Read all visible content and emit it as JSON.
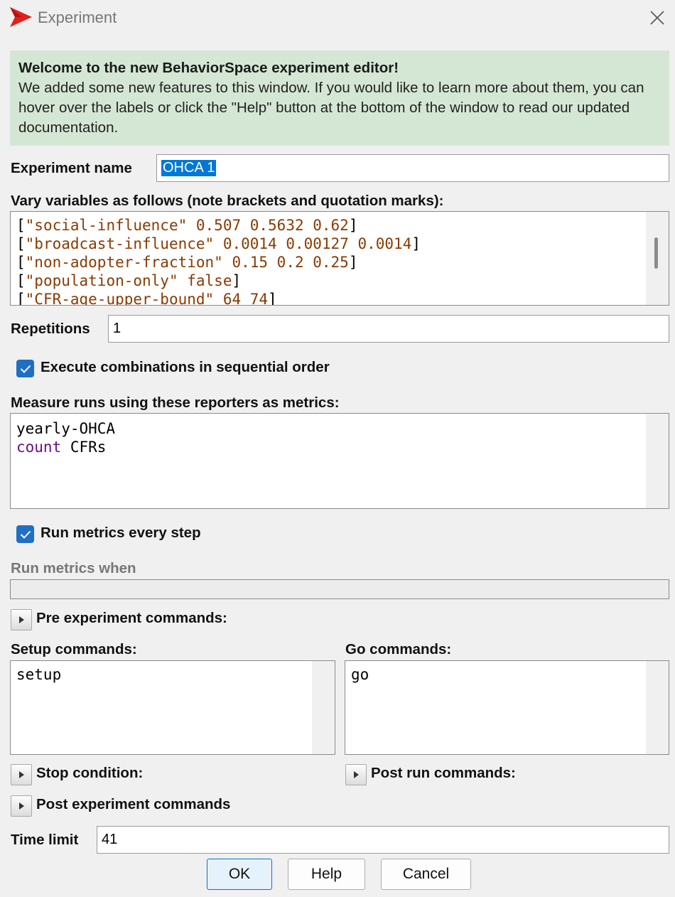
{
  "window": {
    "title": "Experiment",
    "logo_icon": "netlogo-red-arrow-icon",
    "close_icon": "close-x-icon",
    "accent": "#e0201b"
  },
  "banner": {
    "title": "Welcome to the new BehaviorSpace experiment editor!",
    "text": "We added some new features to this window. If you would like to learn more about them, you can hover over the labels or click the \"Help\" button at the bottom of the window to read our updated documentation.",
    "color": "#d4e7d4"
  },
  "experiment_name": {
    "label": "Experiment name",
    "value": "OHCA 1"
  },
  "vary_variables": {
    "label": "Vary variables as follows (note brackets and quotation marks):",
    "lines": [
      {
        "name": "\"social-influence\"",
        "values": "0.507 0.5632 0.62"
      },
      {
        "name": "\"broadcast-influence\"",
        "values": "0.0014 0.00127 0.0014"
      },
      {
        "name": "\"non-adopter-fraction\"",
        "values": "0.15 0.2 0.25"
      },
      {
        "name": "\"population-only\"",
        "values": "false"
      },
      {
        "name": "\"CFR-age-upper-bound\"",
        "values": "64 74"
      }
    ]
  },
  "repetitions": {
    "label": "Repetitions",
    "value": "1"
  },
  "sequential": {
    "label": "Execute combinations in sequential order",
    "checked": true
  },
  "metrics": {
    "label": "Measure runs using these reporters as metrics:",
    "line1": "yearly-OHCA",
    "line2_keyword": "count",
    "line2_rest": " CFRs"
  },
  "run_every_step": {
    "label": "Run metrics every step",
    "checked": true
  },
  "run_metrics_when": {
    "label": "Run metrics when",
    "value": ""
  },
  "pre_experiment": {
    "label": "Pre experiment commands:"
  },
  "setup": {
    "label": "Setup commands:",
    "code": "setup"
  },
  "go": {
    "label": "Go commands:",
    "code": "go"
  },
  "stop_condition": {
    "label": "Stop condition:"
  },
  "post_run": {
    "label": "Post run commands:"
  },
  "post_experiment": {
    "label": "Post experiment commands"
  },
  "time_limit": {
    "label": "Time limit",
    "value": "41"
  },
  "buttons": {
    "ok": "OK",
    "help": "Help",
    "cancel": "Cancel"
  }
}
